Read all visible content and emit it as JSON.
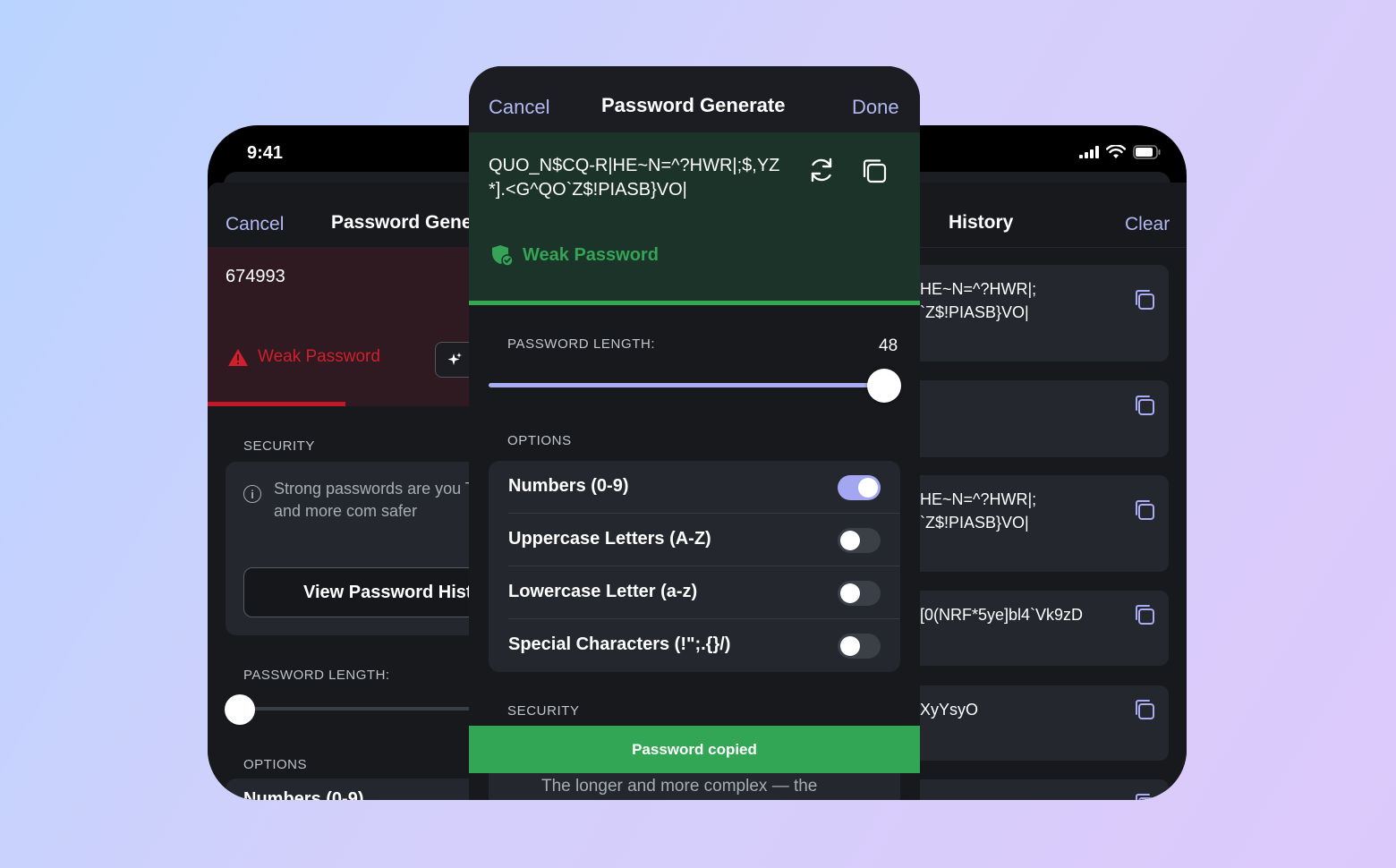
{
  "status_bar": {
    "time": "9:41"
  },
  "left_panel": {
    "nav": {
      "cancel": "Cancel",
      "title": "Password Gene"
    },
    "password": "674993",
    "strength": "Weak Password",
    "security_label": "SECURITY",
    "info_text": "Strong passwords are you The longer and more com safer",
    "history_button": "View Password Histo",
    "length_label": "PASSWORD LENGTH:",
    "options_label": "OPTIONS",
    "first_option": "Numbers (0-9)",
    "colors": {
      "strength": "#d11f2c"
    }
  },
  "right_panel": {
    "title": "History",
    "clear": "Clear",
    "items": [
      {
        "text": "HE~N=^?HWR|;\n`Z$!PIASB}VO|"
      },
      {
        "text": ""
      },
      {
        "text": "HE~N=^?HWR|;\n`Z$!PIASB}VO|"
      },
      {
        "text": "[0(NRF*5ye]bl4`Vk9zD"
      },
      {
        "text": "XyYsyO"
      },
      {
        "text": ""
      }
    ]
  },
  "sheet": {
    "nav": {
      "cancel": "Cancel",
      "title": "Password Generate",
      "done": "Done"
    },
    "password": "QUO_N$CQ-R|HE~N=^?HWR|;$,YZ*].<G^QO`Z$!PIASB}VO|",
    "strength": "Weak Password",
    "length_label": "PASSWORD LENGTH:",
    "length_value": "48",
    "length_fraction": 1.0,
    "options_label": "OPTIONS",
    "options": [
      {
        "label": "Numbers (0-9)",
        "enabled": true
      },
      {
        "label": "Uppercase Letters (A-Z)",
        "enabled": false
      },
      {
        "label": "Lowercase Letter (a-z)",
        "enabled": false
      },
      {
        "label": "Special Characters (!\";.{}/)",
        "enabled": false
      }
    ],
    "security_label": "SECURITY",
    "security_text": "The longer and more complex — the",
    "toast": "Password copied",
    "colors": {
      "accent": "#a9adf6",
      "strength": "#35a456",
      "toast": "#33a655"
    }
  }
}
